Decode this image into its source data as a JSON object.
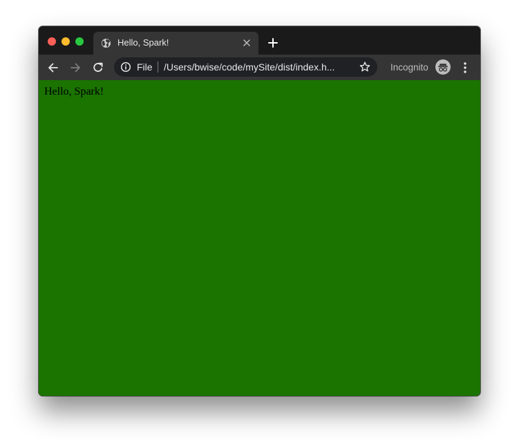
{
  "window": {
    "controls": [
      "close",
      "minimize",
      "maximize"
    ]
  },
  "tab": {
    "title": "Hello, Spark!",
    "icon": "globe-icon"
  },
  "toolbar": {
    "scheme_label": "File",
    "url": "/Users/bwise/code/mySite/dist/index.h...",
    "incognito_label": "Incognito"
  },
  "page": {
    "background_color": "#1b7300",
    "text": "Hello, Spark!"
  },
  "colors": {
    "traffic_close": "#fe5f57",
    "traffic_minimize": "#febc2e",
    "traffic_maximize": "#28c840",
    "chrome_dark": "#1a1a1a",
    "toolbar": "#353535"
  }
}
